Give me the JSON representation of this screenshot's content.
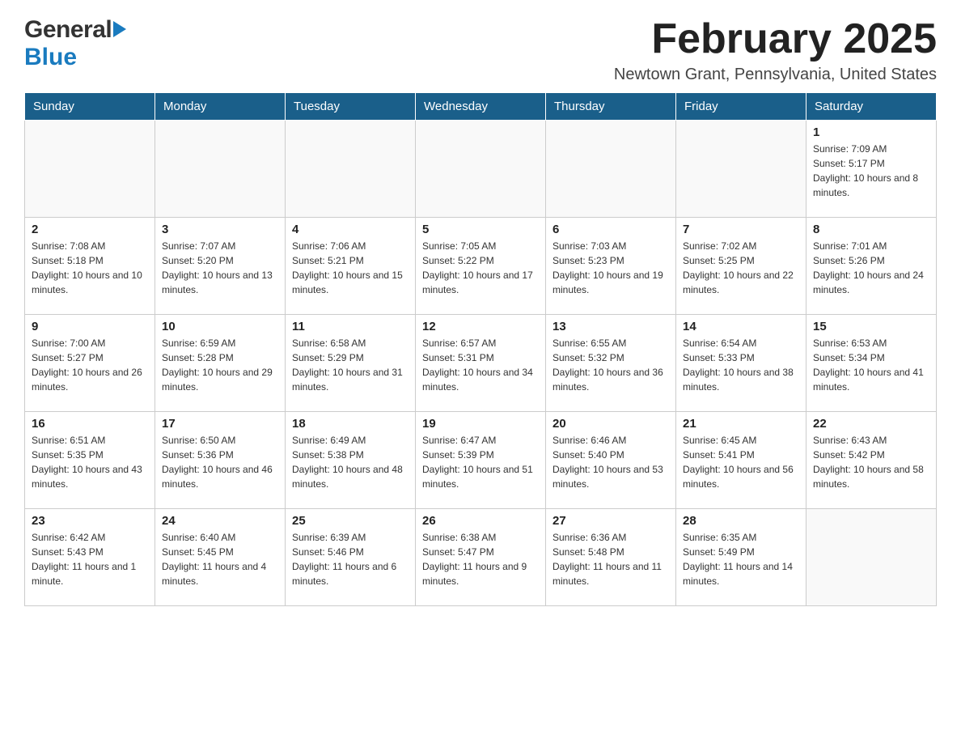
{
  "header": {
    "logo": {
      "general": "General",
      "blue": "Blue"
    },
    "title": "February 2025",
    "subtitle": "Newtown Grant, Pennsylvania, United States"
  },
  "calendar": {
    "days_of_week": [
      "Sunday",
      "Monday",
      "Tuesday",
      "Wednesday",
      "Thursday",
      "Friday",
      "Saturday"
    ],
    "weeks": [
      [
        {
          "day": "",
          "info": ""
        },
        {
          "day": "",
          "info": ""
        },
        {
          "day": "",
          "info": ""
        },
        {
          "day": "",
          "info": ""
        },
        {
          "day": "",
          "info": ""
        },
        {
          "day": "",
          "info": ""
        },
        {
          "day": "1",
          "info": "Sunrise: 7:09 AM\nSunset: 5:17 PM\nDaylight: 10 hours and 8 minutes."
        }
      ],
      [
        {
          "day": "2",
          "info": "Sunrise: 7:08 AM\nSunset: 5:18 PM\nDaylight: 10 hours and 10 minutes."
        },
        {
          "day": "3",
          "info": "Sunrise: 7:07 AM\nSunset: 5:20 PM\nDaylight: 10 hours and 13 minutes."
        },
        {
          "day": "4",
          "info": "Sunrise: 7:06 AM\nSunset: 5:21 PM\nDaylight: 10 hours and 15 minutes."
        },
        {
          "day": "5",
          "info": "Sunrise: 7:05 AM\nSunset: 5:22 PM\nDaylight: 10 hours and 17 minutes."
        },
        {
          "day": "6",
          "info": "Sunrise: 7:03 AM\nSunset: 5:23 PM\nDaylight: 10 hours and 19 minutes."
        },
        {
          "day": "7",
          "info": "Sunrise: 7:02 AM\nSunset: 5:25 PM\nDaylight: 10 hours and 22 minutes."
        },
        {
          "day": "8",
          "info": "Sunrise: 7:01 AM\nSunset: 5:26 PM\nDaylight: 10 hours and 24 minutes."
        }
      ],
      [
        {
          "day": "9",
          "info": "Sunrise: 7:00 AM\nSunset: 5:27 PM\nDaylight: 10 hours and 26 minutes."
        },
        {
          "day": "10",
          "info": "Sunrise: 6:59 AM\nSunset: 5:28 PM\nDaylight: 10 hours and 29 minutes."
        },
        {
          "day": "11",
          "info": "Sunrise: 6:58 AM\nSunset: 5:29 PM\nDaylight: 10 hours and 31 minutes."
        },
        {
          "day": "12",
          "info": "Sunrise: 6:57 AM\nSunset: 5:31 PM\nDaylight: 10 hours and 34 minutes."
        },
        {
          "day": "13",
          "info": "Sunrise: 6:55 AM\nSunset: 5:32 PM\nDaylight: 10 hours and 36 minutes."
        },
        {
          "day": "14",
          "info": "Sunrise: 6:54 AM\nSunset: 5:33 PM\nDaylight: 10 hours and 38 minutes."
        },
        {
          "day": "15",
          "info": "Sunrise: 6:53 AM\nSunset: 5:34 PM\nDaylight: 10 hours and 41 minutes."
        }
      ],
      [
        {
          "day": "16",
          "info": "Sunrise: 6:51 AM\nSunset: 5:35 PM\nDaylight: 10 hours and 43 minutes."
        },
        {
          "day": "17",
          "info": "Sunrise: 6:50 AM\nSunset: 5:36 PM\nDaylight: 10 hours and 46 minutes."
        },
        {
          "day": "18",
          "info": "Sunrise: 6:49 AM\nSunset: 5:38 PM\nDaylight: 10 hours and 48 minutes."
        },
        {
          "day": "19",
          "info": "Sunrise: 6:47 AM\nSunset: 5:39 PM\nDaylight: 10 hours and 51 minutes."
        },
        {
          "day": "20",
          "info": "Sunrise: 6:46 AM\nSunset: 5:40 PM\nDaylight: 10 hours and 53 minutes."
        },
        {
          "day": "21",
          "info": "Sunrise: 6:45 AM\nSunset: 5:41 PM\nDaylight: 10 hours and 56 minutes."
        },
        {
          "day": "22",
          "info": "Sunrise: 6:43 AM\nSunset: 5:42 PM\nDaylight: 10 hours and 58 minutes."
        }
      ],
      [
        {
          "day": "23",
          "info": "Sunrise: 6:42 AM\nSunset: 5:43 PM\nDaylight: 11 hours and 1 minute."
        },
        {
          "day": "24",
          "info": "Sunrise: 6:40 AM\nSunset: 5:45 PM\nDaylight: 11 hours and 4 minutes."
        },
        {
          "day": "25",
          "info": "Sunrise: 6:39 AM\nSunset: 5:46 PM\nDaylight: 11 hours and 6 minutes."
        },
        {
          "day": "26",
          "info": "Sunrise: 6:38 AM\nSunset: 5:47 PM\nDaylight: 11 hours and 9 minutes."
        },
        {
          "day": "27",
          "info": "Sunrise: 6:36 AM\nSunset: 5:48 PM\nDaylight: 11 hours and 11 minutes."
        },
        {
          "day": "28",
          "info": "Sunrise: 6:35 AM\nSunset: 5:49 PM\nDaylight: 11 hours and 14 minutes."
        },
        {
          "day": "",
          "info": ""
        }
      ]
    ]
  }
}
